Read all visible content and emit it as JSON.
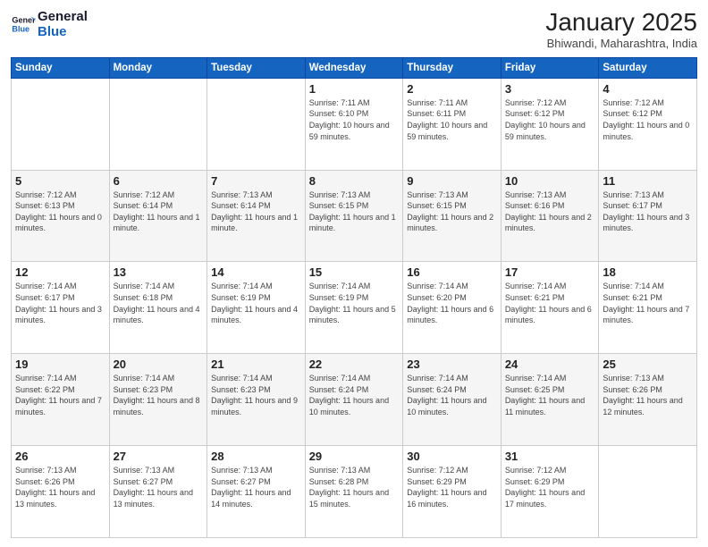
{
  "header": {
    "logo_line1": "General",
    "logo_line2": "Blue",
    "month": "January 2025",
    "location": "Bhiwandi, Maharashtra, India"
  },
  "days_of_week": [
    "Sunday",
    "Monday",
    "Tuesday",
    "Wednesday",
    "Thursday",
    "Friday",
    "Saturday"
  ],
  "weeks": [
    {
      "days": [
        {
          "num": "",
          "info": ""
        },
        {
          "num": "",
          "info": ""
        },
        {
          "num": "",
          "info": ""
        },
        {
          "num": "1",
          "info": "Sunrise: 7:11 AM\nSunset: 6:10 PM\nDaylight: 10 hours and 59 minutes."
        },
        {
          "num": "2",
          "info": "Sunrise: 7:11 AM\nSunset: 6:11 PM\nDaylight: 10 hours and 59 minutes."
        },
        {
          "num": "3",
          "info": "Sunrise: 7:12 AM\nSunset: 6:12 PM\nDaylight: 10 hours and 59 minutes."
        },
        {
          "num": "4",
          "info": "Sunrise: 7:12 AM\nSunset: 6:12 PM\nDaylight: 11 hours and 0 minutes."
        }
      ]
    },
    {
      "days": [
        {
          "num": "5",
          "info": "Sunrise: 7:12 AM\nSunset: 6:13 PM\nDaylight: 11 hours and 0 minutes."
        },
        {
          "num": "6",
          "info": "Sunrise: 7:12 AM\nSunset: 6:14 PM\nDaylight: 11 hours and 1 minute."
        },
        {
          "num": "7",
          "info": "Sunrise: 7:13 AM\nSunset: 6:14 PM\nDaylight: 11 hours and 1 minute."
        },
        {
          "num": "8",
          "info": "Sunrise: 7:13 AM\nSunset: 6:15 PM\nDaylight: 11 hours and 1 minute."
        },
        {
          "num": "9",
          "info": "Sunrise: 7:13 AM\nSunset: 6:15 PM\nDaylight: 11 hours and 2 minutes."
        },
        {
          "num": "10",
          "info": "Sunrise: 7:13 AM\nSunset: 6:16 PM\nDaylight: 11 hours and 2 minutes."
        },
        {
          "num": "11",
          "info": "Sunrise: 7:13 AM\nSunset: 6:17 PM\nDaylight: 11 hours and 3 minutes."
        }
      ]
    },
    {
      "days": [
        {
          "num": "12",
          "info": "Sunrise: 7:14 AM\nSunset: 6:17 PM\nDaylight: 11 hours and 3 minutes."
        },
        {
          "num": "13",
          "info": "Sunrise: 7:14 AM\nSunset: 6:18 PM\nDaylight: 11 hours and 4 minutes."
        },
        {
          "num": "14",
          "info": "Sunrise: 7:14 AM\nSunset: 6:19 PM\nDaylight: 11 hours and 4 minutes."
        },
        {
          "num": "15",
          "info": "Sunrise: 7:14 AM\nSunset: 6:19 PM\nDaylight: 11 hours and 5 minutes."
        },
        {
          "num": "16",
          "info": "Sunrise: 7:14 AM\nSunset: 6:20 PM\nDaylight: 11 hours and 6 minutes."
        },
        {
          "num": "17",
          "info": "Sunrise: 7:14 AM\nSunset: 6:21 PM\nDaylight: 11 hours and 6 minutes."
        },
        {
          "num": "18",
          "info": "Sunrise: 7:14 AM\nSunset: 6:21 PM\nDaylight: 11 hours and 7 minutes."
        }
      ]
    },
    {
      "days": [
        {
          "num": "19",
          "info": "Sunrise: 7:14 AM\nSunset: 6:22 PM\nDaylight: 11 hours and 7 minutes."
        },
        {
          "num": "20",
          "info": "Sunrise: 7:14 AM\nSunset: 6:23 PM\nDaylight: 11 hours and 8 minutes."
        },
        {
          "num": "21",
          "info": "Sunrise: 7:14 AM\nSunset: 6:23 PM\nDaylight: 11 hours and 9 minutes."
        },
        {
          "num": "22",
          "info": "Sunrise: 7:14 AM\nSunset: 6:24 PM\nDaylight: 11 hours and 10 minutes."
        },
        {
          "num": "23",
          "info": "Sunrise: 7:14 AM\nSunset: 6:24 PM\nDaylight: 11 hours and 10 minutes."
        },
        {
          "num": "24",
          "info": "Sunrise: 7:14 AM\nSunset: 6:25 PM\nDaylight: 11 hours and 11 minutes."
        },
        {
          "num": "25",
          "info": "Sunrise: 7:13 AM\nSunset: 6:26 PM\nDaylight: 11 hours and 12 minutes."
        }
      ]
    },
    {
      "days": [
        {
          "num": "26",
          "info": "Sunrise: 7:13 AM\nSunset: 6:26 PM\nDaylight: 11 hours and 13 minutes."
        },
        {
          "num": "27",
          "info": "Sunrise: 7:13 AM\nSunset: 6:27 PM\nDaylight: 11 hours and 13 minutes."
        },
        {
          "num": "28",
          "info": "Sunrise: 7:13 AM\nSunset: 6:27 PM\nDaylight: 11 hours and 14 minutes."
        },
        {
          "num": "29",
          "info": "Sunrise: 7:13 AM\nSunset: 6:28 PM\nDaylight: 11 hours and 15 minutes."
        },
        {
          "num": "30",
          "info": "Sunrise: 7:12 AM\nSunset: 6:29 PM\nDaylight: 11 hours and 16 minutes."
        },
        {
          "num": "31",
          "info": "Sunrise: 7:12 AM\nSunset: 6:29 PM\nDaylight: 11 hours and 17 minutes."
        },
        {
          "num": "",
          "info": ""
        }
      ]
    }
  ]
}
